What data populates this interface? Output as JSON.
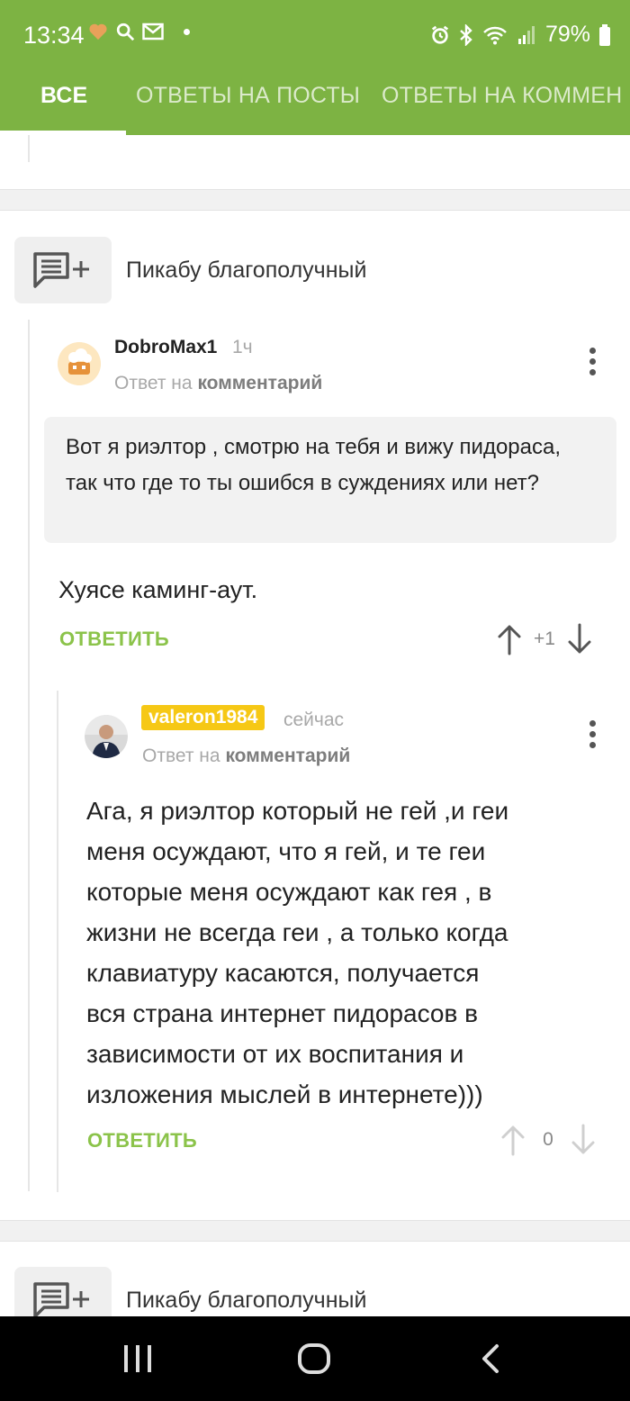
{
  "status_bar": {
    "time": "13:34",
    "battery": "79%"
  },
  "tabs": [
    {
      "label": "ВСЕ",
      "active": true
    },
    {
      "label": "ОТВЕТЫ НА ПОСТЫ",
      "active": false
    },
    {
      "label": "ОТВЕТЫ НА КОММЕН",
      "active": false
    }
  ],
  "posts": [
    {
      "title": "Пикабу благополучный",
      "comments": [
        {
          "username": "DobroMax1",
          "time": "1ч",
          "reply_prefix": "Ответ на",
          "reply_target": "комментарий",
          "quote": "Вот я риэлтор , смотрю на тебя и вижу пидораса, так что где то ты ошибся в суждениях или нет?",
          "text": "Хуясе каминг-аут.",
          "reply_label": "ОТВЕТИТЬ",
          "rating": "+1"
        },
        {
          "username": "valeron1984",
          "time": "сейчас",
          "reply_prefix": "Ответ на",
          "reply_target": "комментарий",
          "text_lines": [
            "Ага, я риэлтор который не гей ,и геи",
            "меня осуждают, что я гей, и те геи",
            "которые меня осуждают как гея , в",
            "жизни не всегда геи , а только когда",
            "клавиатуру касаются, получается",
            "вся страна интернет пидорасов в",
            "зависимости от их воспитания и",
            "изложения мыслей в интернете)))"
          ],
          "reply_label": "ОТВЕТИТЬ",
          "rating": "0"
        }
      ]
    },
    {
      "title": "Пикабу благополучный"
    }
  ],
  "colors": {
    "brand_green": "#7db343",
    "action_green": "#8bc34a",
    "username_badge": "#f6c815"
  }
}
